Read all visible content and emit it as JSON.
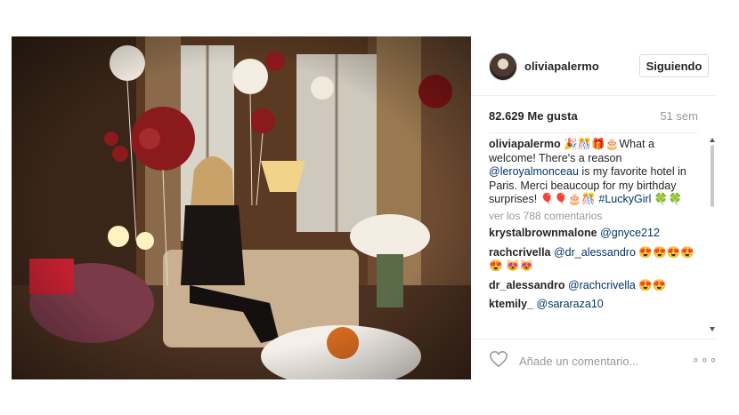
{
  "post": {
    "author": "oliviapalermo",
    "follow_label": "Siguiendo",
    "likes": "82.629 Me gusta",
    "time_ago": "51 sem",
    "caption": {
      "user": "oliviapalermo",
      "text_part1": " 🎉🎊🎁🎂What a welcome! There's a reason ",
      "mention": "@leroyalmonceau",
      "text_part2": " is my favorite hotel in Paris. Merci beaucoup for my birthday surprises! 🎈🎈🎂🎊 ",
      "hashtag": "#LuckyGirl",
      "text_part3": " 🍀🍀"
    },
    "view_all": "ver los 788 comentarios",
    "comments": [
      {
        "user": "krystalbrownmalone",
        "mention": "@gnyce212",
        "text": ""
      },
      {
        "user": "rachcrivella",
        "mention": "@dr_alessandro",
        "text": " 😍😍😍😍😍 😻😻"
      },
      {
        "user": "dr_alessandro",
        "mention": "@rachcrivella",
        "text": " 😍😍"
      },
      {
        "user": "ktemily_",
        "mention": "@sararaza10",
        "text": ""
      },
      {
        "user": "",
        "mention": "",
        "text": ""
      }
    ],
    "comment_placeholder": "Añade un comentario...",
    "more_label": "∘∘∘"
  },
  "icons": {
    "like": "heart-outline-icon",
    "more": "more-options-icon",
    "avatar": "profile-avatar"
  },
  "colors": {
    "link": "#003569",
    "muted": "#999999",
    "border": "#dbdbdb"
  }
}
